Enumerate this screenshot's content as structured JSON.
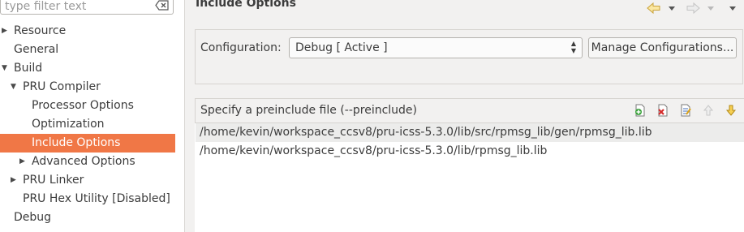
{
  "filter": {
    "placeholder": "type filter text",
    "clear_icon": "clear-filter-icon"
  },
  "tree": [
    {
      "label": "Resource",
      "twisty": "▶"
    },
    {
      "label": "General",
      "twisty": ""
    },
    {
      "label": "Build",
      "twisty": "▼"
    },
    {
      "label": "PRU Compiler",
      "twisty": "▼"
    },
    {
      "label": "Processor Options",
      "twisty": ""
    },
    {
      "label": "Optimization",
      "twisty": ""
    },
    {
      "label": "Include Options",
      "twisty": "",
      "selected": true
    },
    {
      "label": "Advanced Options",
      "twisty": "▶"
    },
    {
      "label": "PRU Linker",
      "twisty": "▶"
    },
    {
      "label": "PRU Hex Utility  [Disabled]",
      "twisty": ""
    },
    {
      "label": "Debug",
      "twisty": ""
    }
  ],
  "page": {
    "title": "Include Options"
  },
  "nav": {
    "back_icon": "back-arrow-icon",
    "forward_icon": "forward-arrow-icon",
    "menu_icon": "view-menu-icon"
  },
  "configuration": {
    "label": "Configuration:",
    "value": "Debug  [ Active ]",
    "manage_button": "Manage Configurations..."
  },
  "preinclude": {
    "title": "Specify a preinclude file (--preinclude)",
    "tools": [
      "add-icon",
      "delete-icon",
      "edit-icon",
      "move-up-icon",
      "move-down-icon"
    ],
    "files": [
      {
        "path": "/home/kevin/workspace_ccsv8/pru-icss-5.3.0/lib/src/rpmsg_lib/gen/rpmsg_lib.lib",
        "selected": true
      },
      {
        "path": "/home/kevin/workspace_ccsv8/pru-icss-5.3.0/lib/rpmsg_lib.lib",
        "selected": false
      }
    ]
  },
  "colors": {
    "selection": "#f07746",
    "panel": "#f2f1f0",
    "list_bg": "#ffffff"
  }
}
